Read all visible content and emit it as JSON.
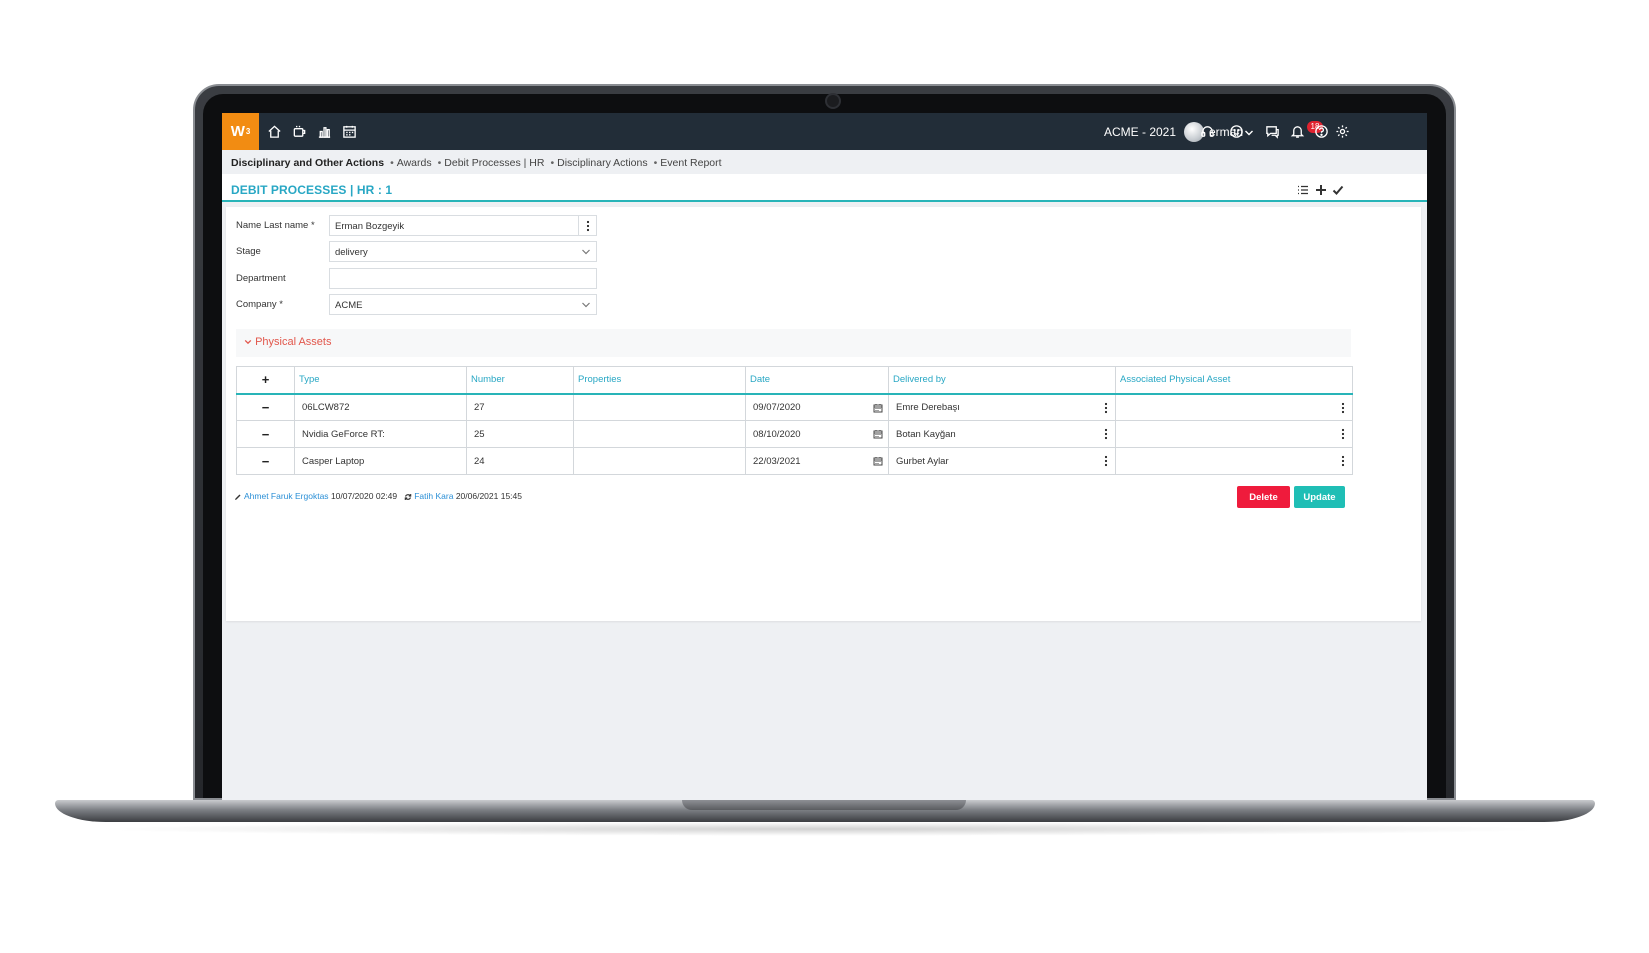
{
  "app": {
    "logo_text": "W",
    "logo_sup": "3",
    "company": "ACME - 2021",
    "username": "erman",
    "notification_count": "18",
    "accent": "#28b4b8",
    "topbar_bg": "#222d38",
    "logo_bg": "#f28c12"
  },
  "nav_icons": [
    "home-icon",
    "coffee-icon",
    "bar-chart-icon",
    "calendar-icon"
  ],
  "top_icons": [
    "headset-icon",
    "emoji-icon",
    "chat-icon",
    "bell-icon",
    "help-icon",
    "gear-icon"
  ],
  "breadcrumb": {
    "first": "Disciplinary and Other Actions",
    "items": [
      "Awards",
      "Debit Processes | HR",
      "Disciplinary Actions",
      "Event Report"
    ]
  },
  "page": {
    "title": "DEBIT PROCESSES | HR : 1",
    "header_icons": [
      "list-icon",
      "plus-icon",
      "check-icon"
    ]
  },
  "form": {
    "name_label": "Name Last name *",
    "name_value": "Erman Bozgeyik",
    "stage_label": "Stage",
    "stage_value": "delivery",
    "department_label": "Department",
    "department_value": "",
    "company_label": "Company *",
    "company_value": "ACME"
  },
  "section": {
    "title": "Physical Assets"
  },
  "table": {
    "add_symbol": "+",
    "remove_symbol": "−",
    "columns": [
      "Type",
      "Number",
      "Properties",
      "Date",
      "Delivered by",
      "Associated Physical Asset"
    ],
    "rows": [
      {
        "type": "06LCW872",
        "number": "27",
        "properties": "",
        "date": "09/07/2020",
        "delivered_by": "Emre Derebaşı",
        "asset": ""
      },
      {
        "type": "Nvidia GeForce RT:",
        "number": "25",
        "properties": "",
        "date": "08/10/2020",
        "delivered_by": "Botan Kayğan",
        "asset": ""
      },
      {
        "type": "Casper Laptop",
        "number": "24",
        "properties": "",
        "date": "22/03/2021",
        "delivered_by": "Gurbet Aylar",
        "asset": ""
      }
    ]
  },
  "footer": {
    "created_by": "Ahmet Faruk Ergoktas",
    "created_at": "10/07/2020 02:49",
    "updated_by": "Fatih Kara",
    "updated_at": "20/06/2021 15:45"
  },
  "buttons": {
    "delete": "Delete",
    "update": "Update",
    "delete_color": "#ef1b3c",
    "update_color": "#1fbeb5"
  }
}
